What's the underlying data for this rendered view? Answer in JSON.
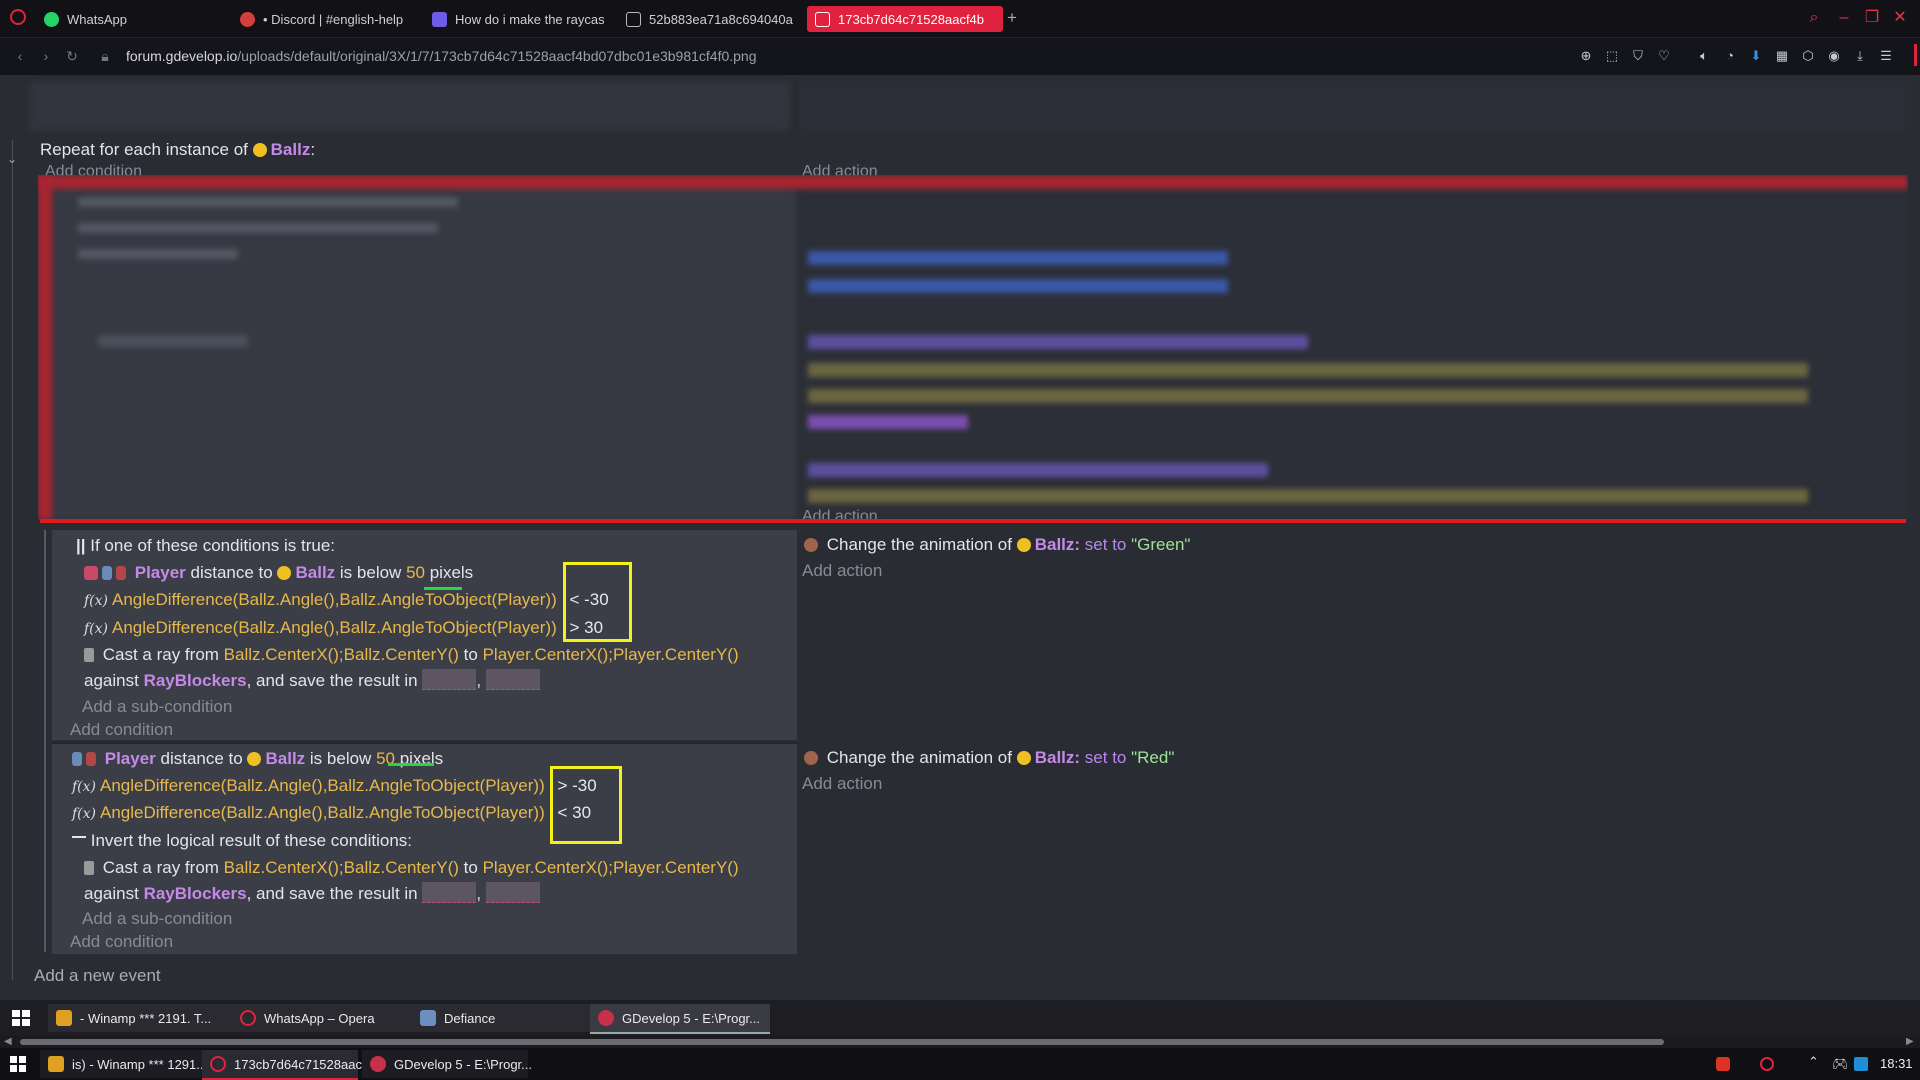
{
  "browser": {
    "tabs": [
      {
        "label": "WhatsApp",
        "color": "#25d366"
      },
      {
        "label": "• Discord | #english-help",
        "color": "#d33e3e"
      },
      {
        "label": "How do i make the raycas",
        "color": "#6c5ce7"
      },
      {
        "label": "52b883ea71a8c694040a",
        "color": "#bbbbbb"
      },
      {
        "label": "173cb7d64c71528aacf4b",
        "color": "#ffffff"
      }
    ],
    "add_tab": "+",
    "url_host": "forum.gdevelop.io",
    "url_path": "/uploads/default/original/3X/1/7/173cb7d64c71528aacf4bd07dbc01e3b981cf4f0.png"
  },
  "events": {
    "repeat_prefix": "Repeat for each instance of",
    "repeat_object": "Ballz",
    "repeat_suffix": ":",
    "add_condition": "Add condition",
    "add_action": "Add action",
    "or_header": "If one of these conditions is true:",
    "or_marker": "||",
    "cond_player": "Player",
    "cond_distance": "distance to",
    "cond_ballz": "Ballz",
    "cond_below": "is below",
    "cond_50": "50",
    "cond_pixels": "pixels",
    "angle_expr": "AngleDifference(Ballz.Angle(),Ballz.AngleToObject(Player))",
    "lt": "<",
    "gt": ">",
    "neg30": "-30",
    "pos30": "30",
    "cast_prefix": "Cast a ray from",
    "cast_from": "Ballz.CenterX();Ballz.CenterY()",
    "cast_to_word": "to",
    "cast_to": "Player.CenterX();Player.CenterY()",
    "against": "against",
    "rayblockers": "RayBlockers",
    "save_result": ", and save the result in",
    "comma": ",",
    "add_subcondition": "Add a sub-condition",
    "invert_label": "Invert the logical result of these conditions:",
    "change_anim": "Change the animation of",
    "ballz_colon": "Ballz:",
    "set_to": "set to",
    "green": "\"Green\"",
    "red": "\"Red\"",
    "add_new_event": "Add a new event"
  },
  "taskbar_top": [
    {
      "label": "- Winamp *** 2191. T..."
    },
    {
      "label": "WhatsApp – Opera"
    },
    {
      "label": "Defiance"
    },
    {
      "label": "GDevelop 5 - E:\\Progr..."
    }
  ],
  "taskbar_bottom": [
    {
      "label": "is) - Winamp *** 1291..."
    },
    {
      "label": "173cb7d64c71528aacf..."
    },
    {
      "label": "GDevelop 5 - E:\\Progr..."
    }
  ],
  "clock": "18:31",
  "colors": {
    "accent": "#e0223f",
    "highlight_box": "#f2f21a",
    "underline": "#25d842",
    "object": "#c58ae8",
    "expression": "#e7b84a"
  }
}
